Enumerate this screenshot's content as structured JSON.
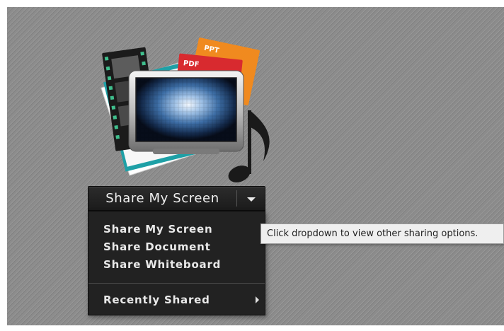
{
  "share_button": {
    "label": "Share My Screen",
    "dropdown_icon": "chevron-down-icon"
  },
  "menu": {
    "items": [
      {
        "label": "Share My Screen"
      },
      {
        "label": "Share Document"
      },
      {
        "label": "Share Whiteboard"
      }
    ],
    "recent": {
      "label": "Recently Shared",
      "icon": "submenu-arrow-icon"
    }
  },
  "illustration": {
    "badges": {
      "ppt": "PPT",
      "pdf": "PDF"
    },
    "icons": [
      "film-strip-icon",
      "document-stack-icon",
      "monitor-icon",
      "music-note-icon"
    ]
  },
  "tooltip": {
    "text": "Click dropdown to view other sharing options."
  },
  "colors": {
    "background": "#8c8c8c",
    "menu": "#222222",
    "ppt_badge": "#e8731c",
    "pdf_badge": "#d8262b"
  }
}
